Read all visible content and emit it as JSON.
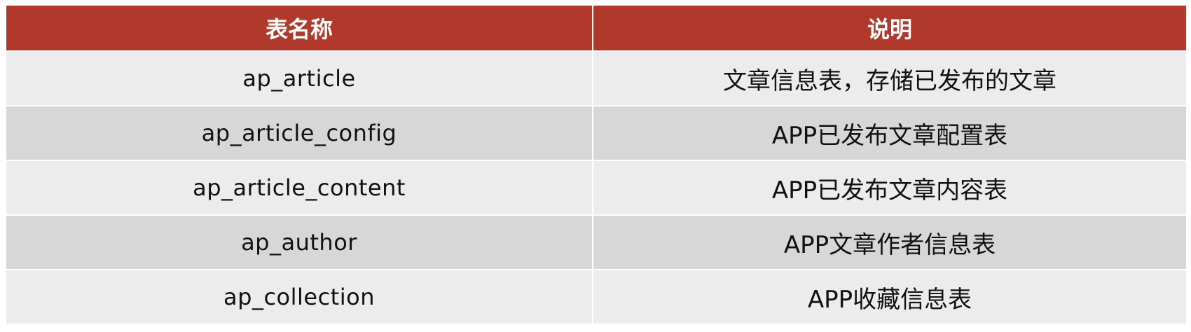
{
  "table": {
    "headers": [
      "表名称",
      "说明"
    ],
    "rows": [
      {
        "name": "ap_article",
        "desc": "文章信息表，存储已发布的文章"
      },
      {
        "name": "ap_article_config",
        "desc": "APP已发布文章配置表"
      },
      {
        "name": "ap_article_content",
        "desc": "APP已发布文章内容表"
      },
      {
        "name": "ap_author",
        "desc": "APP文章作者信息表"
      },
      {
        "name": "ap_collection",
        "desc": "APP收藏信息表"
      }
    ]
  },
  "colors": {
    "header_bg": "#b0392b",
    "header_text": "#ffffff",
    "row_odd_bg": "#ececec",
    "row_even_bg": "#d7d7d7"
  }
}
